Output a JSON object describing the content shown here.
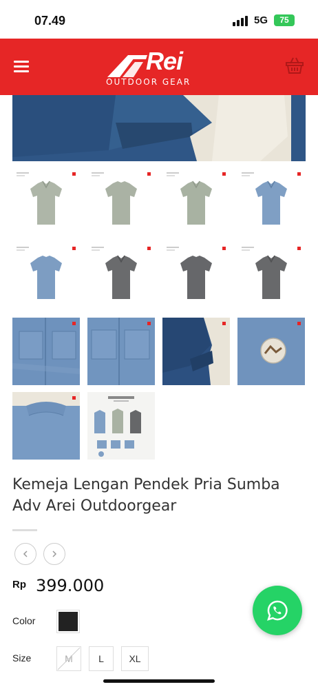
{
  "status_bar": {
    "time": "07.49",
    "network": "5G",
    "battery": "75"
  },
  "header": {
    "logo_text": "Rei",
    "logo_subtitle": "OUTDOOR GEAR",
    "menu_icon": "hamburger-menu-icon",
    "cart_icon": "shopping-basket-icon"
  },
  "colors": {
    "brand_red": "#e62626",
    "whatsapp_green": "#25d366"
  },
  "gallery": {
    "thumbnails": [
      {
        "label": "sage-shirt-front"
      },
      {
        "label": "sage-shirt-back"
      },
      {
        "label": "sage-shirt-front-2"
      },
      {
        "label": "blue-shirt-front"
      },
      {
        "label": "blue-shirt-back"
      },
      {
        "label": "grey-shirt-front"
      },
      {
        "label": "grey-shirt-back"
      },
      {
        "label": "grey-shirt-front-2"
      },
      {
        "label": "blue-pocket-detail"
      },
      {
        "label": "blue-pocket-detail-2"
      },
      {
        "label": "navy-sleeve-detail"
      },
      {
        "label": "logo-patch-detail"
      },
      {
        "label": "collar-back-detail"
      },
      {
        "label": "sumba-adv-promo"
      }
    ]
  },
  "product": {
    "title": "Kemeja Lengan Pendek Pria Sumba Adv Arei Outdoorgear",
    "currency": "Rp",
    "price": "399.000"
  },
  "options": {
    "color_label": "Color",
    "color_value": "#222222",
    "size_label": "Size",
    "sizes": [
      {
        "label": "M",
        "available": false
      },
      {
        "label": "L",
        "available": true
      },
      {
        "label": "XL",
        "available": true
      }
    ]
  },
  "floating": {
    "whatsapp_icon": "whatsapp-icon"
  }
}
